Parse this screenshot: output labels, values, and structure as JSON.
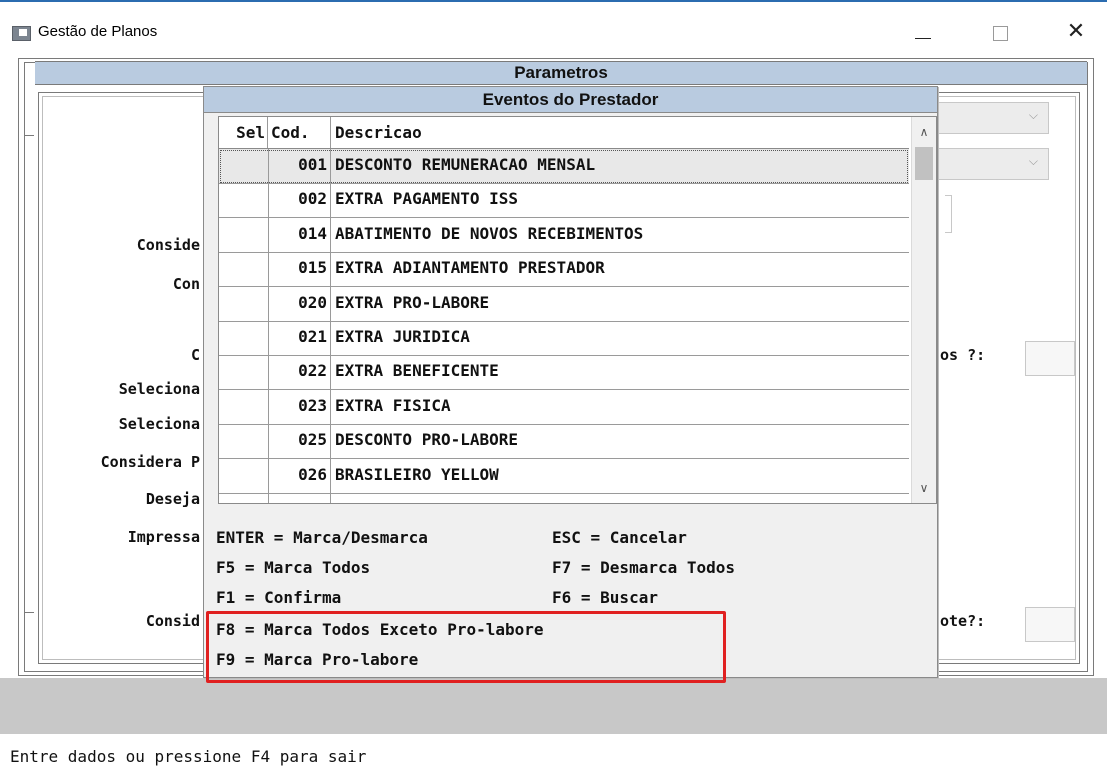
{
  "window": {
    "title": "Gestão de Planos",
    "minimize_glyph": "",
    "maximize_glyph": "",
    "close_glyph": "✕",
    "icon": "app-window-icon"
  },
  "background_form": {
    "section_title": "Parametros",
    "labels": [
      "Conside",
      "Con",
      "C",
      "Seleciona",
      "Seleciona",
      "Considera P",
      "Deseja",
      "Impressa",
      "Consid"
    ],
    "right_labels": [
      "os ?:",
      "ote?:"
    ]
  },
  "dialog": {
    "title": "Eventos do Prestador",
    "columns": {
      "sel": "Sel",
      "cod": "Cod.",
      "desc": "Descricao"
    },
    "rows": [
      {
        "sel": "",
        "cod": "001",
        "desc": "DESCONTO REMUNERACAO MENSAL",
        "selected": true
      },
      {
        "sel": "",
        "cod": "002",
        "desc": "EXTRA PAGAMENTO ISS"
      },
      {
        "sel": "",
        "cod": "014",
        "desc": "ABATIMENTO DE NOVOS RECEBIMENTOS"
      },
      {
        "sel": "",
        "cod": "015",
        "desc": "EXTRA ADIANTAMENTO PRESTADOR"
      },
      {
        "sel": "",
        "cod": "020",
        "desc": "EXTRA PRO-LABORE"
      },
      {
        "sel": "",
        "cod": "021",
        "desc": "EXTRA JURIDICA"
      },
      {
        "sel": "",
        "cod": "022",
        "desc": "EXTRA BENEFICENTE"
      },
      {
        "sel": "",
        "cod": "023",
        "desc": "EXTRA FISICA"
      },
      {
        "sel": "",
        "cod": "025",
        "desc": "DESCONTO PRO-LABORE"
      },
      {
        "sel": "",
        "cod": "026",
        "desc": "BRASILEIRO YELLOW"
      }
    ],
    "scroll_up": "^",
    "scroll_down": "v",
    "help": {
      "enter": "ENTER = Marca/Desmarca",
      "esc": "ESC = Cancelar",
      "f5": "F5 = Marca Todos",
      "f7": "F7 = Desmarca Todos",
      "f1": "F1 = Confirma",
      "f6": "F6 = Buscar",
      "f8": "F8 = Marca Todos Exceto Pro-labore",
      "f9": "F9 = Marca Pro-labore"
    }
  },
  "status_bar": {
    "text": "Entre dados ou pressione F4 para sair"
  },
  "colors": {
    "header_bar": "#b9cbe0",
    "highlight_border": "#e02020",
    "footer_gray": "#c8c8c8"
  }
}
